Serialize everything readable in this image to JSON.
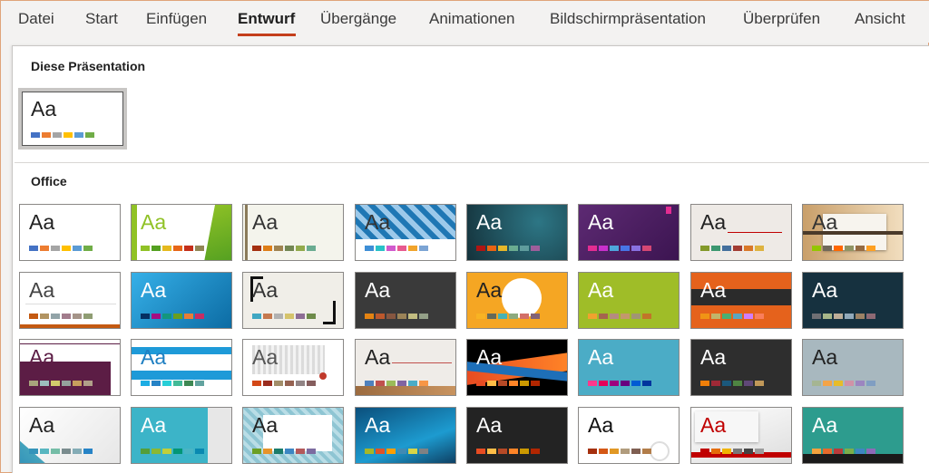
{
  "tabs": [
    {
      "label": "Datei",
      "active": false
    },
    {
      "label": "Start",
      "active": false
    },
    {
      "label": "Einfügen",
      "active": false
    },
    {
      "label": "Entwurf",
      "active": true
    },
    {
      "label": "Übergänge",
      "active": false
    },
    {
      "label": "Animationen",
      "active": false
    },
    {
      "label": "Bildschirmpräsentation",
      "active": false
    },
    {
      "label": "Überprüfen",
      "active": false
    },
    {
      "label": "Ansicht",
      "active": false
    }
  ],
  "colors": {
    "accent": "#c43e1c"
  },
  "sections": {
    "this_presentation": "Diese Präsentation",
    "office": "Office"
  },
  "current_theme": {
    "label": "Aa",
    "selected": true,
    "bg": "#ffffff",
    "fg": "#222222",
    "swatches": [
      "#4472c4",
      "#ed7d31",
      "#a5a5a5",
      "#ffc000",
      "#5b9bd5",
      "#70ad47"
    ]
  },
  "office_themes": [
    {
      "label": "Aa",
      "bg": "#ffffff",
      "fg": "#222222",
      "swatches": [
        "#4472c4",
        "#ed7d31",
        "#a5a5a5",
        "#ffc000",
        "#5b9bd5",
        "#70ad47"
      ]
    },
    {
      "label": "Aa",
      "bg": "#ffffff",
      "fg": "#90c226",
      "deco": "facet",
      "swatches": [
        "#90c226",
        "#54a021",
        "#e6b91e",
        "#e76618",
        "#c42f1a",
        "#918655"
      ]
    },
    {
      "label": "Aa",
      "bg": "#f4f4ec",
      "fg": "#333333",
      "deco": "integral",
      "swatches": [
        "#a53010",
        "#de7e18",
        "#9f8351",
        "#728653",
        "#92aa4c",
        "#6aac91"
      ]
    },
    {
      "label": "Aa",
      "bg": "#ffffff",
      "fg": "#333333",
      "deco": "pattern",
      "swatches": [
        "#3e8ed6",
        "#2ac1c8",
        "#d15acd",
        "#e85a8f",
        "#f1a42c",
        "#7ca4d4"
      ]
    },
    {
      "label": "Aa",
      "bg": "#1f4e5a",
      "fg": "#ffffff",
      "deco": "ion",
      "swatches": [
        "#b01513",
        "#ea6312",
        "#e6b729",
        "#6aac90",
        "#5f9c9d",
        "#9e5e9b"
      ]
    },
    {
      "label": "Aa",
      "bg": "#4b1e5c",
      "fg": "#ffffff",
      "deco": "ionboard",
      "swatches": [
        "#e32d91",
        "#c830cc",
        "#4ea6dc",
        "#4775e7",
        "#8971e1",
        "#d54773"
      ]
    },
    {
      "label": "Aa",
      "bg": "#eeeae6",
      "fg": "#222222",
      "deco": "organic",
      "swatches": [
        "#83992a",
        "#3c9770",
        "#44709d",
        "#a23c33",
        "#d97828",
        "#deb340"
      ]
    },
    {
      "label": "Aa",
      "bg": "#e2c79f",
      "fg": "#333333",
      "deco": "wood",
      "swatches": [
        "#94c600",
        "#71685a",
        "#ff6700",
        "#909465",
        "#956b43",
        "#fea022"
      ]
    },
    {
      "label": "Aa",
      "bg": "#ffffff",
      "fg": "#444444",
      "deco": "retro",
      "swatches": [
        "#c45911",
        "#b29462",
        "#92a4a8",
        "#a27c8c",
        "#a59488",
        "#8f9d73"
      ]
    },
    {
      "label": "Aa",
      "bg": "#2a9fd8",
      "fg": "#ffffff",
      "deco": "slice",
      "swatches": [
        "#052f61",
        "#a50e82",
        "#14967c",
        "#6a9e1f",
        "#e87d37",
        "#c62d64"
      ]
    },
    {
      "label": "Aa",
      "bg": "#f0eee8",
      "fg": "#333333",
      "deco": "frame",
      "swatches": [
        "#40a7c2",
        "#c5784e",
        "#b1b1b1",
        "#d5c36b",
        "#8e6e95",
        "#6e8b4a"
      ]
    },
    {
      "label": "Aa",
      "bg": "#3a3a3a",
      "fg": "#ffffff",
      "deco": "none",
      "swatches": [
        "#e48312",
        "#bd582c",
        "#865640",
        "#9b8357",
        "#c2bc80",
        "#94a088"
      ]
    },
    {
      "label": "Aa",
      "bg": "#f5a623",
      "fg": "#222222",
      "deco": "badge",
      "swatches": [
        "#f8b323",
        "#656a59",
        "#46b2b5",
        "#8caa7e",
        "#d36f68",
        "#826276"
      ]
    },
    {
      "label": "Aa",
      "bg": "#9fbd28",
      "fg": "#ffffff",
      "deco": "none",
      "swatches": [
        "#f0a22e",
        "#a5644e",
        "#b58b80",
        "#c3986d",
        "#a19574",
        "#c17529"
      ]
    },
    {
      "label": "Aa",
      "bg": "#e5621c",
      "fg": "#ffffff",
      "deco": "mesh",
      "swatches": [
        "#f09415",
        "#c1b56b",
        "#4baf73",
        "#5aa6c0",
        "#d17df9",
        "#fa7e5c"
      ]
    },
    {
      "label": "Aa",
      "bg": "#16313f",
      "fg": "#ffffff",
      "deco": "none",
      "swatches": [
        "#6f6f74",
        "#a7b789",
        "#beae98",
        "#92a9b9",
        "#9c8265",
        "#8d6974"
      ]
    },
    {
      "label": "Aa",
      "bg": "#ffffff",
      "fg": "#5c1d45",
      "deco": "plum",
      "swatches": [
        "#a9a57c",
        "#9cbebd",
        "#d2cb6c",
        "#95a39d",
        "#c89f5d",
        "#b1a089"
      ]
    },
    {
      "label": "Aa",
      "bg": "#ffffff",
      "fg": "#1e7fc2",
      "deco": "band",
      "swatches": [
        "#1cade4",
        "#2683c6",
        "#27ced7",
        "#42ba97",
        "#3e8853",
        "#62a39f"
      ]
    },
    {
      "label": "Aa",
      "bg": "#ffffff",
      "fg": "#555555",
      "deco": "wisp",
      "swatches": [
        "#d34817",
        "#9b2d1f",
        "#a28e6a",
        "#956251",
        "#918485",
        "#855d5d"
      ]
    },
    {
      "label": "Aa",
      "bg": "#efece8",
      "fg": "#222222",
      "deco": "floor",
      "swatches": [
        "#4f81bd",
        "#c0504d",
        "#9bbb59",
        "#8064a2",
        "#4bacc6",
        "#f79646"
      ]
    },
    {
      "label": "Aa",
      "bg": "#000000",
      "fg": "#ffffff",
      "deco": "swoosh",
      "swatches": [
        "#e84c22",
        "#ffbd47",
        "#b64926",
        "#ff8427",
        "#cc9900",
        "#b22600"
      ]
    },
    {
      "label": "Aa",
      "bg": "#4bacc6",
      "fg": "#ffffff",
      "deco": "none",
      "swatches": [
        "#ff388c",
        "#e40059",
        "#9c007f",
        "#68007f",
        "#005bd3",
        "#00349e"
      ]
    },
    {
      "label": "Aa",
      "bg": "#2e2e2e",
      "fg": "#ffffff",
      "deco": "none",
      "swatches": [
        "#f07f09",
        "#9f2936",
        "#1b587c",
        "#4e8542",
        "#604878",
        "#c19859"
      ]
    },
    {
      "label": "Aa",
      "bg": "#a8b8bf",
      "fg": "#222222",
      "deco": "none",
      "swatches": [
        "#a5b592",
        "#f3a447",
        "#e7bc29",
        "#d092a7",
        "#9c85c0",
        "#809ec2"
      ]
    },
    {
      "label": "Aa",
      "bg": "#ffffff",
      "fg": "#222222",
      "deco": "ribbon",
      "swatches": [
        "#3494ba",
        "#58b6c0",
        "#75bda7",
        "#7a8c8e",
        "#84acb6",
        "#2683c6"
      ]
    },
    {
      "label": "Aa",
      "bg": "#3cb4c8",
      "fg": "#ffffff",
      "deco": "panel",
      "swatches": [
        "#549e39",
        "#8ab833",
        "#c0cf3a",
        "#029676",
        "#4ab5c4",
        "#0989b1"
      ]
    },
    {
      "label": "Aa",
      "bg": "#b9dde6",
      "fg": "#222222",
      "deco": "card",
      "swatches": [
        "#6b9f25",
        "#e6942b",
        "#1b7c6b",
        "#3c86c3",
        "#b3595b",
        "#7c6ba0"
      ]
    },
    {
      "label": "Aa",
      "bg": "#1d7bb0",
      "fg": "#ffffff",
      "deco": "waves",
      "swatches": [
        "#a6b727",
        "#df5327",
        "#fe9e00",
        "#418ab3",
        "#d7d447",
        "#818183"
      ]
    },
    {
      "label": "Aa",
      "bg": "#232323",
      "fg": "#ffffff",
      "deco": "none",
      "swatches": [
        "#e84c22",
        "#ffbd47",
        "#b64926",
        "#ff8427",
        "#cc9900",
        "#b22600"
      ]
    },
    {
      "label": "Aa",
      "bg": "#ffffff",
      "fg": "#111111",
      "deco": "gears",
      "swatches": [
        "#a5300f",
        "#d55816",
        "#e19825",
        "#b19c7d",
        "#7f5f52",
        "#b27d49"
      ]
    },
    {
      "label": "Aa",
      "bg": "#ffffff",
      "fg": "#c00000",
      "deco": "red",
      "swatches": [
        "#c00000",
        "#e46c0a",
        "#f0b400",
        "#777777",
        "#444444",
        "#9c9c9c"
      ]
    },
    {
      "label": "Aa",
      "bg": "#2d9c8e",
      "fg": "#ffffff",
      "deco": "tealdark",
      "swatches": [
        "#f2a23e",
        "#e46a2c",
        "#b93b3b",
        "#7cae4a",
        "#3e86c3",
        "#8d6ab8"
      ]
    }
  ]
}
